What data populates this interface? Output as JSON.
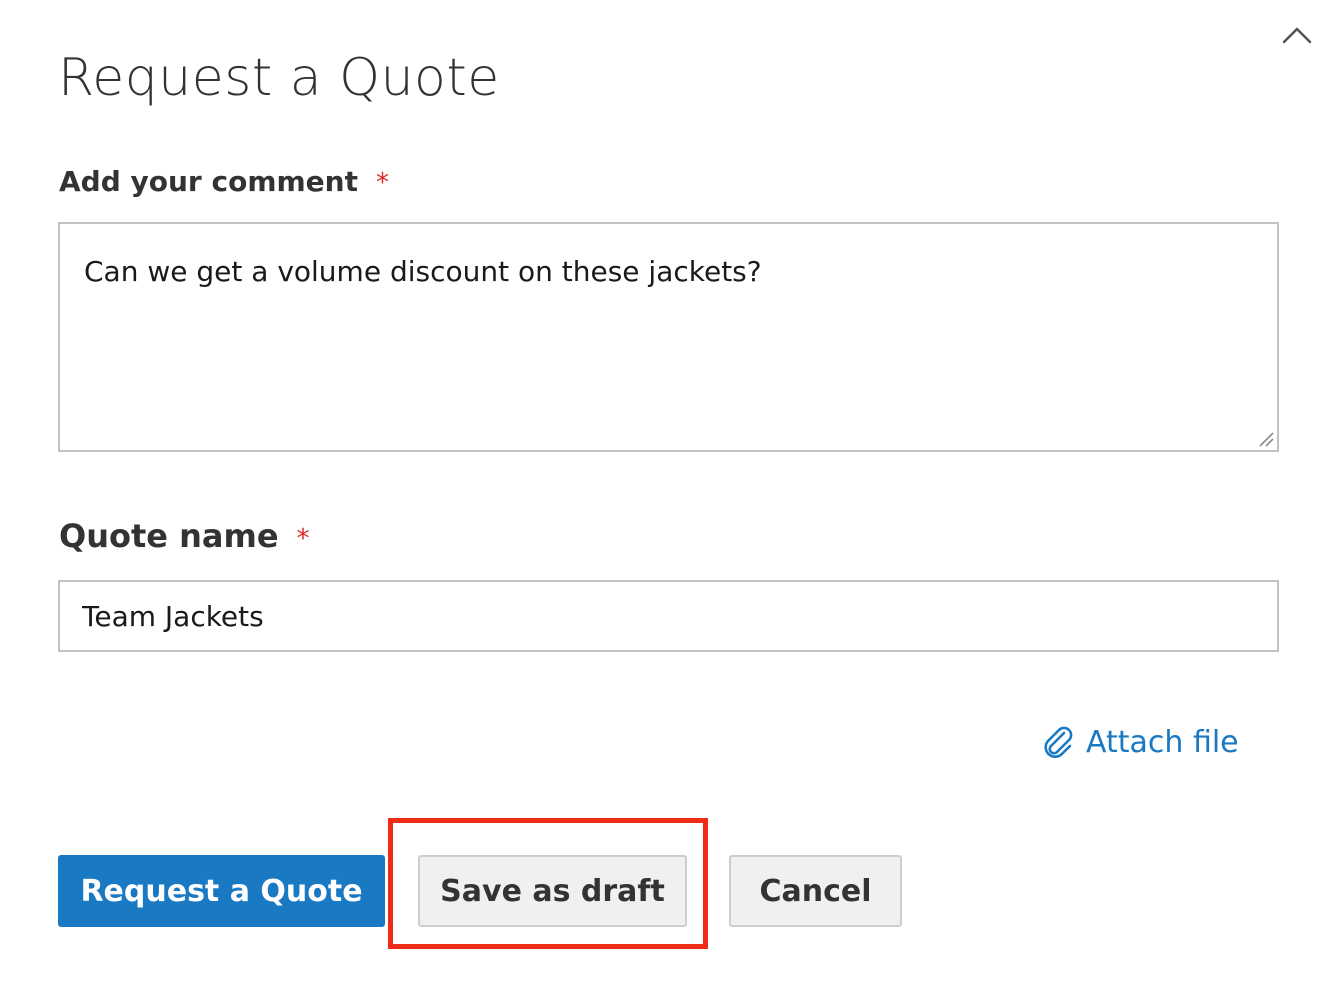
{
  "header": {
    "title": "Request a Quote",
    "collapse_icon": "chevron-up-icon"
  },
  "comment": {
    "label": "Add your comment",
    "required_mark": "*",
    "value": "Can we get a volume discount on these jackets?"
  },
  "quote_name": {
    "label": "Quote name",
    "required_mark": "*",
    "value": "Team Jackets"
  },
  "attach": {
    "label": "Attach file",
    "icon": "paperclip-icon"
  },
  "actions": {
    "request_label": "Request a Quote",
    "draft_label": "Save as draft",
    "cancel_label": "Cancel"
  },
  "colors": {
    "primary": "#1979c3",
    "required": "#e02b27",
    "highlight": "#ee2b17"
  }
}
